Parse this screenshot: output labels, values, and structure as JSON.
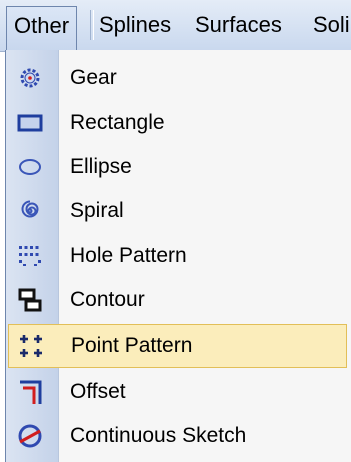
{
  "menubar": {
    "items": [
      {
        "label": "Other",
        "active": true
      },
      {
        "label": "Splines"
      },
      {
        "label": "Surfaces"
      },
      {
        "label": "Soli"
      }
    ]
  },
  "dropdown": {
    "items": [
      {
        "label": "Gear",
        "icon": "gear-icon"
      },
      {
        "label": "Rectangle",
        "icon": "rectangle-icon"
      },
      {
        "label": "Ellipse",
        "icon": "ellipse-icon"
      },
      {
        "label": "Spiral",
        "icon": "spiral-icon"
      },
      {
        "label": "Hole Pattern",
        "icon": "hole-pattern-icon"
      },
      {
        "label": "Contour",
        "icon": "contour-icon"
      },
      {
        "label": "Point Pattern",
        "icon": "point-pattern-icon",
        "highlighted": true
      },
      {
        "label": "Offset",
        "icon": "offset-icon"
      },
      {
        "label": "Continuous Sketch",
        "icon": "continuous-sketch-icon"
      }
    ]
  },
  "colors": {
    "highlight_bg": "#fbedbb",
    "highlight_border": "#e2bf58",
    "icon_blue": "#1f3e9e",
    "icon_red": "#d21e1e"
  }
}
